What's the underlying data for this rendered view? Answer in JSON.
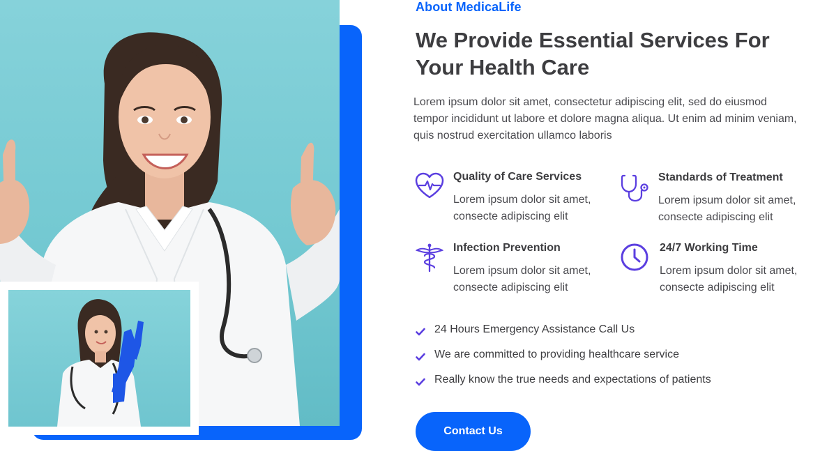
{
  "about": {
    "eyebrow": "About MedicaLife",
    "heading": "We Provide Essential Services For Your Health Care",
    "intro": "Lorem ipsum dolor sit amet, consectetur adipiscing elit, sed do eiusmod tempor incididunt ut labore et dolore magna aliqua. Ut enim ad minim veniam, quis nostrud exercitation ullamco laboris"
  },
  "features": [
    {
      "title": "Quality of Care Services",
      "desc": "Lorem ipsum dolor sit amet, consecte adipiscing elit",
      "icon": "heart-pulse-icon"
    },
    {
      "title": "Standards of Treatment",
      "desc": "Lorem ipsum dolor sit amet, consecte adipiscing elit",
      "icon": "stethoscope-icon"
    },
    {
      "title": "Infection Prevention",
      "desc": "Lorem ipsum dolor sit amet, consecte adipiscing elit",
      "icon": "caduceus-icon"
    },
    {
      "title": "24/7 Working Time",
      "desc": "Lorem ipsum dolor sit amet, consecte adipiscing elit",
      "icon": "clock-icon"
    }
  ],
  "checklist": [
    "24 Hours Emergency Assistance Call Us",
    "We are committed to providing healthcare service",
    "Really know the true needs and expectations of patients"
  ],
  "cta": {
    "label": "Contact Us"
  },
  "colors": {
    "accent": "#0864fb",
    "icon": "#5b3fe0",
    "photo_background": "#7fcfd7",
    "heading": "#3d3d40"
  }
}
